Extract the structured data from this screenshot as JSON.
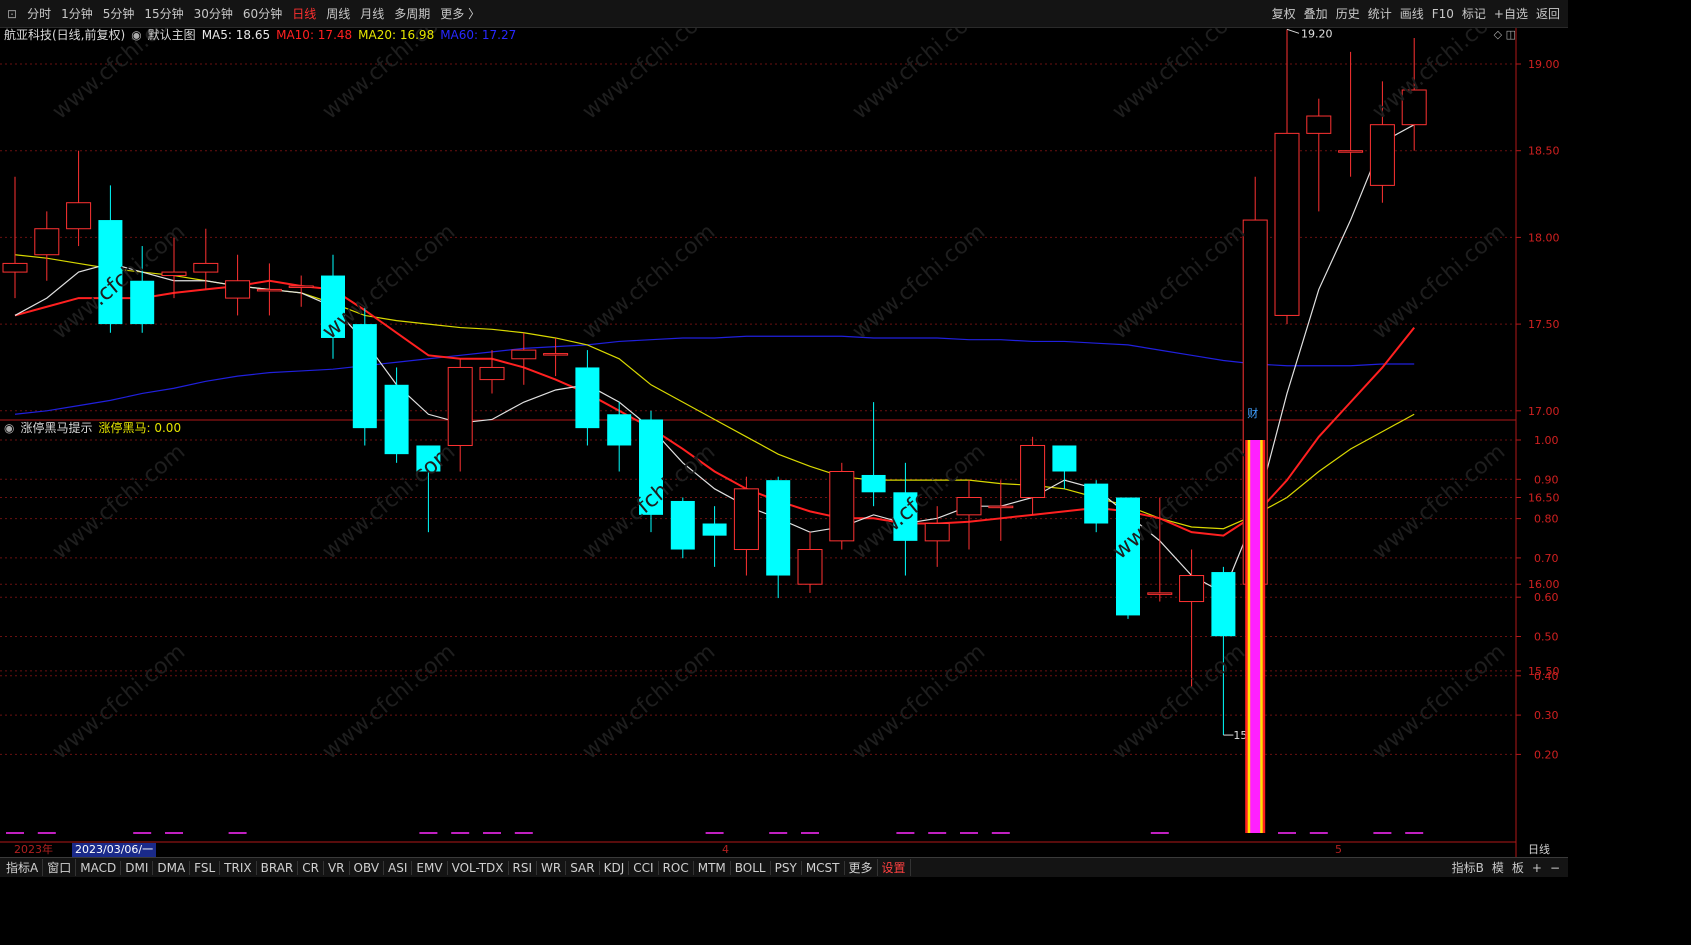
{
  "toolbar": {
    "periods": [
      "分时",
      "1分钟",
      "5分钟",
      "15分钟",
      "30分钟",
      "60分钟",
      "日线",
      "周线",
      "月线",
      "多周期",
      "更多 〉"
    ],
    "active_period": "日线",
    "right_tools": [
      "复权",
      "叠加",
      "历史",
      "统计",
      "画线",
      "F10",
      "标记",
      "+自选",
      "返回"
    ]
  },
  "header": {
    "stock": "航亚科技(日线,前复权)",
    "main_label": "默认主图",
    "ma5": "MA5: 18.65",
    "ma10": "MA10: 17.48",
    "ma20": "MA20: 16.98",
    "ma60": "MA60: 17.27",
    "colors": {
      "ma5": "#e8e8e8",
      "ma10": "#ff2020",
      "ma20": "#e6e600",
      "ma60": "#2020ff"
    }
  },
  "sub": {
    "name": "涨停黑马提示",
    "value": "涨停黑马: 0.00"
  },
  "dates": {
    "year": "2023年",
    "cursor": "2023/03/06/一",
    "m4": "4",
    "m5": "5",
    "freq": "日线"
  },
  "bottom_tabs": [
    "指标A",
    "窗口",
    "MACD",
    "DMI",
    "DMA",
    "FSL",
    "TRIX",
    "BRAR",
    "CR",
    "VR",
    "OBV",
    "ASI",
    "EMV",
    "VOL-TDX",
    "RSI",
    "WR",
    "SAR",
    "KDJ",
    "CCI",
    "ROC",
    "MTM",
    "BOLL",
    "PSY",
    "MCST",
    "更多",
    "设置"
  ],
  "bottom_right": [
    "指标B",
    "模",
    "板",
    "+",
    "−"
  ],
  "chart_data": [
    {
      "type": "candlestick",
      "ylim": [
        15.0,
        19.3
      ],
      "yticks": [
        15.5,
        16.0,
        16.5,
        17.0,
        17.5,
        18.0,
        18.5,
        19.0
      ],
      "annotations": {
        "high": "19.20",
        "low": "15.13",
        "event": "财"
      },
      "candles": [
        [
          17.8,
          17.85,
          18.35,
          17.65
        ],
        [
          17.9,
          18.05,
          18.15,
          17.75
        ],
        [
          18.05,
          18.2,
          18.5,
          17.95
        ],
        [
          18.1,
          17.5,
          18.3,
          17.45
        ],
        [
          17.75,
          17.5,
          17.95,
          17.45
        ],
        [
          17.78,
          17.8,
          18.0,
          17.65
        ],
        [
          17.8,
          17.85,
          18.05,
          17.7
        ],
        [
          17.65,
          17.75,
          17.9,
          17.55
        ],
        [
          17.7,
          17.7,
          17.85,
          17.55
        ],
        [
          17.72,
          17.72,
          17.78,
          17.6
        ],
        [
          17.78,
          17.42,
          17.9,
          17.3
        ],
        [
          17.5,
          16.9,
          17.6,
          16.8
        ],
        [
          17.15,
          16.75,
          17.25,
          16.7
        ],
        [
          16.8,
          16.65,
          16.8,
          16.3
        ],
        [
          16.8,
          17.25,
          17.3,
          16.65
        ],
        [
          17.18,
          17.25,
          17.35,
          17.1
        ],
        [
          17.3,
          17.35,
          17.45,
          17.15
        ],
        [
          17.33,
          17.33,
          17.42,
          17.2
        ],
        [
          17.25,
          16.9,
          17.35,
          16.8
        ],
        [
          16.98,
          16.8,
          17.05,
          16.65
        ],
        [
          16.95,
          16.4,
          17.0,
          16.3
        ],
        [
          16.48,
          16.2,
          16.5,
          16.15
        ],
        [
          16.35,
          16.28,
          16.45,
          16.1
        ],
        [
          16.2,
          16.55,
          16.62,
          16.05
        ],
        [
          16.6,
          16.05,
          16.62,
          15.92
        ],
        [
          16.0,
          16.2,
          16.3,
          15.95
        ],
        [
          16.25,
          16.65,
          16.7,
          16.2
        ],
        [
          16.63,
          16.53,
          17.05,
          16.45
        ],
        [
          16.53,
          16.25,
          16.7,
          16.05
        ],
        [
          16.25,
          16.35,
          16.45,
          16.1
        ],
        [
          16.4,
          16.5,
          16.6,
          16.2
        ],
        [
          16.45,
          16.45,
          16.6,
          16.25
        ],
        [
          16.5,
          16.8,
          16.85,
          16.4
        ],
        [
          16.8,
          16.65,
          16.8,
          16.55
        ],
        [
          16.58,
          16.35,
          16.6,
          16.3
        ],
        [
          16.5,
          15.82,
          16.5,
          15.8
        ],
        [
          15.95,
          15.95,
          16.5,
          15.9
        ],
        [
          15.9,
          16.05,
          16.2,
          15.4
        ],
        [
          16.07,
          15.7,
          16.1,
          15.13
        ],
        [
          16.0,
          18.1,
          18.35,
          15.95
        ],
        [
          17.55,
          18.6,
          19.2,
          17.5
        ],
        [
          18.6,
          18.7,
          18.8,
          18.15
        ],
        [
          18.5,
          18.5,
          19.07,
          18.35
        ],
        [
          18.3,
          18.65,
          18.9,
          18.2
        ],
        [
          18.65,
          18.85,
          19.15,
          18.5
        ]
      ],
      "ma5": [
        17.55,
        17.65,
        17.8,
        17.85,
        17.8,
        17.75,
        17.75,
        17.72,
        17.7,
        17.68,
        17.6,
        17.4,
        17.15,
        16.98,
        16.93,
        16.95,
        17.05,
        17.12,
        17.15,
        17.05,
        16.9,
        16.7,
        16.55,
        16.45,
        16.38,
        16.3,
        16.33,
        16.4,
        16.35,
        16.38,
        16.45,
        16.45,
        16.5,
        16.6,
        16.55,
        16.4,
        16.25,
        16.05,
        15.95,
        16.4,
        17.1,
        17.7,
        18.1,
        18.55,
        18.65
      ],
      "ma10": [
        17.55,
        17.6,
        17.65,
        17.65,
        17.65,
        17.68,
        17.7,
        17.72,
        17.75,
        17.72,
        17.7,
        17.58,
        17.45,
        17.32,
        17.3,
        17.3,
        17.25,
        17.18,
        17.1,
        17.0,
        16.9,
        16.78,
        16.65,
        16.55,
        16.48,
        16.42,
        16.38,
        16.38,
        16.35,
        16.35,
        16.36,
        16.38,
        16.4,
        16.42,
        16.44,
        16.42,
        16.38,
        16.3,
        16.28,
        16.4,
        16.6,
        16.85,
        17.05,
        17.25,
        17.48
      ],
      "ma20": [
        17.9,
        17.88,
        17.85,
        17.82,
        17.8,
        17.78,
        17.75,
        17.72,
        17.7,
        17.68,
        17.62,
        17.55,
        17.52,
        17.5,
        17.48,
        17.47,
        17.45,
        17.42,
        17.38,
        17.3,
        17.15,
        17.05,
        16.95,
        16.85,
        16.75,
        16.68,
        16.62,
        16.6,
        16.6,
        16.6,
        16.6,
        16.58,
        16.57,
        16.55,
        16.5,
        16.45,
        16.38,
        16.33,
        16.32,
        16.4,
        16.5,
        16.65,
        16.78,
        16.88,
        16.98
      ],
      "ma60": [
        16.98,
        17.0,
        17.03,
        17.06,
        17.1,
        17.13,
        17.17,
        17.2,
        17.22,
        17.23,
        17.24,
        17.26,
        17.28,
        17.3,
        17.32,
        17.34,
        17.36,
        17.37,
        17.38,
        17.4,
        17.41,
        17.42,
        17.42,
        17.43,
        17.43,
        17.43,
        17.43,
        17.42,
        17.42,
        17.42,
        17.41,
        17.41,
        17.4,
        17.4,
        17.39,
        17.38,
        17.35,
        17.32,
        17.29,
        17.27,
        17.26,
        17.26,
        17.26,
        17.27,
        17.27
      ]
    },
    {
      "type": "bar",
      "title": "涨停黑马提示",
      "ylim": [
        0,
        1.0
      ],
      "yticks": [
        0.2,
        0.3,
        0.4,
        0.5,
        0.6,
        0.7,
        0.8,
        0.9,
        1.0
      ],
      "signal_index": 39,
      "values": [
        0,
        0,
        0,
        0,
        0,
        0,
        0,
        0,
        0,
        0,
        0,
        0,
        0,
        0,
        0,
        0,
        0,
        0,
        0,
        0,
        0,
        0,
        0,
        0,
        0,
        0,
        0,
        0,
        0,
        0,
        0,
        0,
        0,
        0,
        0,
        0,
        0,
        0,
        0,
        1,
        0,
        0,
        0,
        0,
        0
      ],
      "baseline_marks": [
        0,
        1,
        4,
        5,
        7,
        13,
        14,
        15,
        16,
        22,
        24,
        25,
        28,
        29,
        30,
        31,
        36,
        40,
        41,
        43,
        44
      ]
    }
  ]
}
